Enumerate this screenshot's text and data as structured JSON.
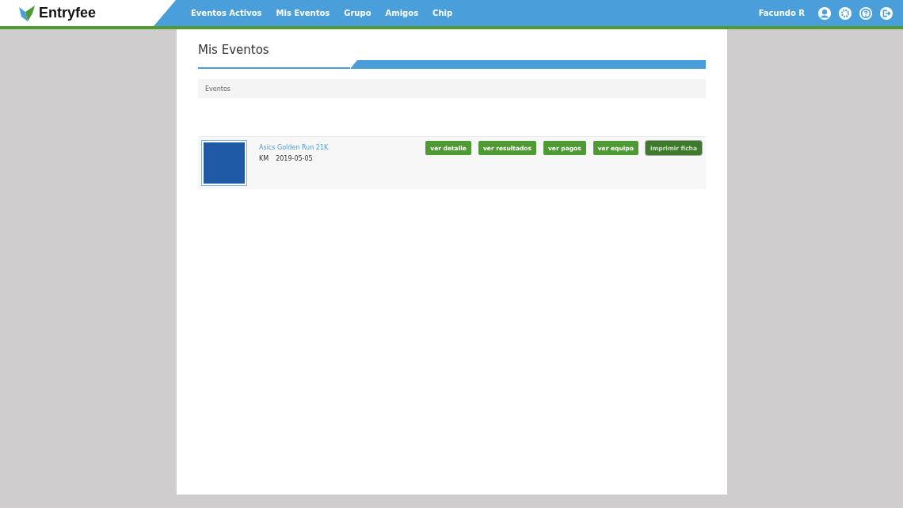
{
  "brand": {
    "name": "Entryfee"
  },
  "nav": [
    {
      "label": "Eventos Activos"
    },
    {
      "label": "Mis Eventos"
    },
    {
      "label": "Grupo"
    },
    {
      "label": "Amigos"
    },
    {
      "label": "Chip"
    }
  ],
  "user": {
    "name": "Facundo R"
  },
  "page": {
    "title": "Mis Eventos",
    "section": "Eventos"
  },
  "events": [
    {
      "name": "Asics Golden Run 21K",
      "unit": "KM",
      "date": "2019-05-05",
      "actions": [
        {
          "label": "ver detalle",
          "selected": false
        },
        {
          "label": "ver resultados",
          "selected": false
        },
        {
          "label": "ver pagos",
          "selected": false
        },
        {
          "label": "ver equipo",
          "selected": false
        },
        {
          "label": "imprimir ficha",
          "selected": true
        }
      ]
    }
  ]
}
